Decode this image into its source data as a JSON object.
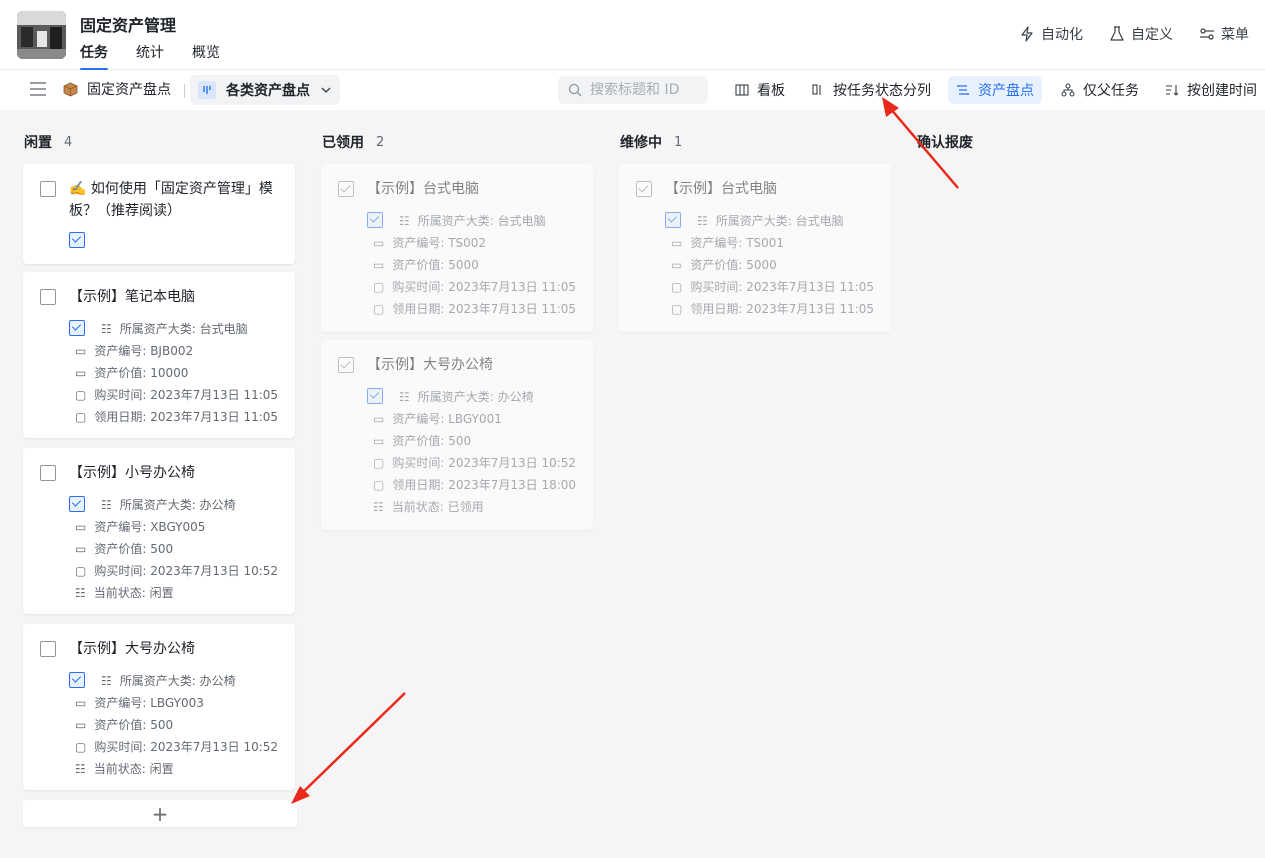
{
  "app": {
    "title": "固定资产管理",
    "tabs": [
      {
        "label": "任务",
        "active": true
      },
      {
        "label": "统计",
        "active": false
      },
      {
        "label": "概览",
        "active": false
      }
    ],
    "actions": [
      {
        "label": "自动化",
        "icon": "lightning-icon"
      },
      {
        "label": "自定义",
        "icon": "flask-icon"
      },
      {
        "label": "菜单",
        "icon": "sliders-icon"
      }
    ]
  },
  "toolbar": {
    "project": "固定资产盘点",
    "view": "各类资产盘点",
    "search_placeholder": "搜索标题和 ID",
    "buttons": [
      "看板",
      "按任务状态分列",
      "资产盘点",
      "仅父任务",
      "按创建时间"
    ]
  },
  "columns": [
    {
      "name": "闲置",
      "count": "4"
    },
    {
      "name": "已领用",
      "count": "2"
    },
    {
      "name": "维修中",
      "count": "1"
    },
    {
      "name": "确认报废",
      "count": ""
    }
  ],
  "cards": {
    "c1": {
      "title": "✍️ 如何使用「固定资产管理」模板？（推荐阅读）"
    },
    "c2": {
      "title": "【示例】笔记本电脑",
      "category": "所属资产大类: 台式电脑",
      "code": "资产编号: BJB002",
      "value": "资产价值: 10000",
      "buy": "购买时间: 2023年7月13日 11:05",
      "use": "领用日期: 2023年7月13日 11:05"
    },
    "c3": {
      "title": "【示例】小号办公椅",
      "category": "所属资产大类: 办公椅",
      "code": "资产编号: XBGY005",
      "value": "资产价值: 500",
      "buy": "购买时间: 2023年7月13日 10:52",
      "state": "当前状态: 闲置"
    },
    "c4": {
      "title": "【示例】大号办公椅",
      "category": "所属资产大类: 办公椅",
      "code": "资产编号: LBGY003",
      "value": "资产价值: 500",
      "buy": "购买时间: 2023年7月13日 10:52",
      "state": "当前状态: 闲置"
    },
    "c5": {
      "title": "【示例】台式电脑",
      "category": "所属资产大类: 台式电脑",
      "code": "资产编号: TS002",
      "value": "资产价值: 5000",
      "buy": "购买时间: 2023年7月13日 11:05",
      "use": "领用日期: 2023年7月13日 11:05"
    },
    "c6": {
      "title": "【示例】大号办公椅",
      "category": "所属资产大类: 办公椅",
      "code": "资产编号: LBGY001",
      "value": "资产价值: 500",
      "buy": "购买时间: 2023年7月13日 10:52",
      "use": "领用日期: 2023年7月13日 18:00",
      "state": "当前状态: 已领用"
    },
    "c7": {
      "title": "【示例】台式电脑",
      "category": "所属资产大类: 台式电脑",
      "code": "资产编号: TS001",
      "value": "资产价值: 5000",
      "buy": "购买时间: 2023年7月13日 11:05",
      "use": "领用日期: 2023年7月13日 11:05"
    }
  },
  "add_label": "+",
  "colors": {
    "accent": "#2a6ff2",
    "annotation": "#e8291c"
  }
}
